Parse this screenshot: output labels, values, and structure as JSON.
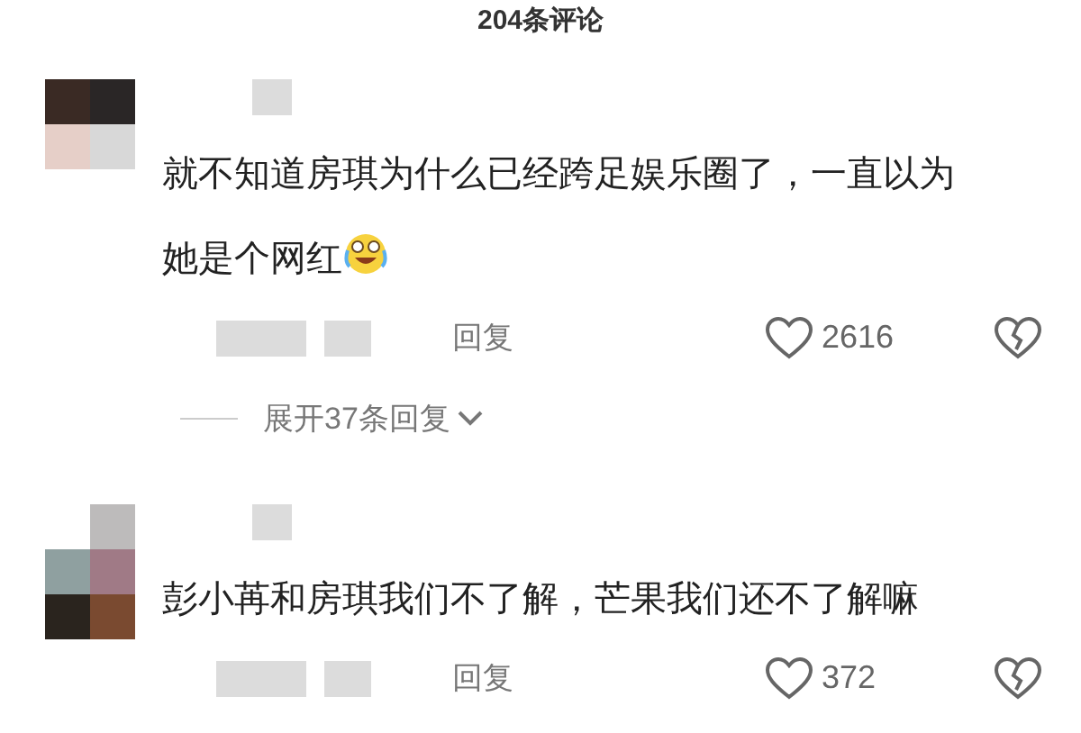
{
  "header": {
    "title": "204条评论"
  },
  "comments": [
    {
      "text": "就不知道房琪为什么已经跨足娱乐圈了，一直以为她是个网红",
      "emoji": true,
      "reply_label": "回复",
      "likes": "2616",
      "expand_replies": "展开37条回复"
    },
    {
      "text": "彭小苒和房琪我们不了解，芒果我们还不了解嘛",
      "emoji": false,
      "reply_label": "回复",
      "likes": "372"
    }
  ]
}
